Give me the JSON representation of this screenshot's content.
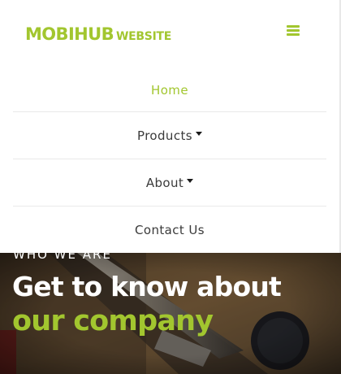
{
  "header": {
    "brand_main": "MOBIHUB",
    "brand_sub": "WEBSITE",
    "menu_icon": "hamburger-menu-icon"
  },
  "nav": {
    "items": [
      {
        "label": "Home",
        "active": true,
        "dropdown": false
      },
      {
        "label": "Products",
        "active": false,
        "dropdown": true
      },
      {
        "label": "About",
        "active": false,
        "dropdown": true
      },
      {
        "label": "Contact Us",
        "active": false,
        "dropdown": false
      }
    ]
  },
  "hero": {
    "kicker": "WHO WE ARE",
    "title_line1": "Get to know about",
    "title_line2": "our company"
  },
  "colors": {
    "accent": "#a2c62f",
    "text": "#3a3a3a",
    "white": "#ffffff"
  }
}
